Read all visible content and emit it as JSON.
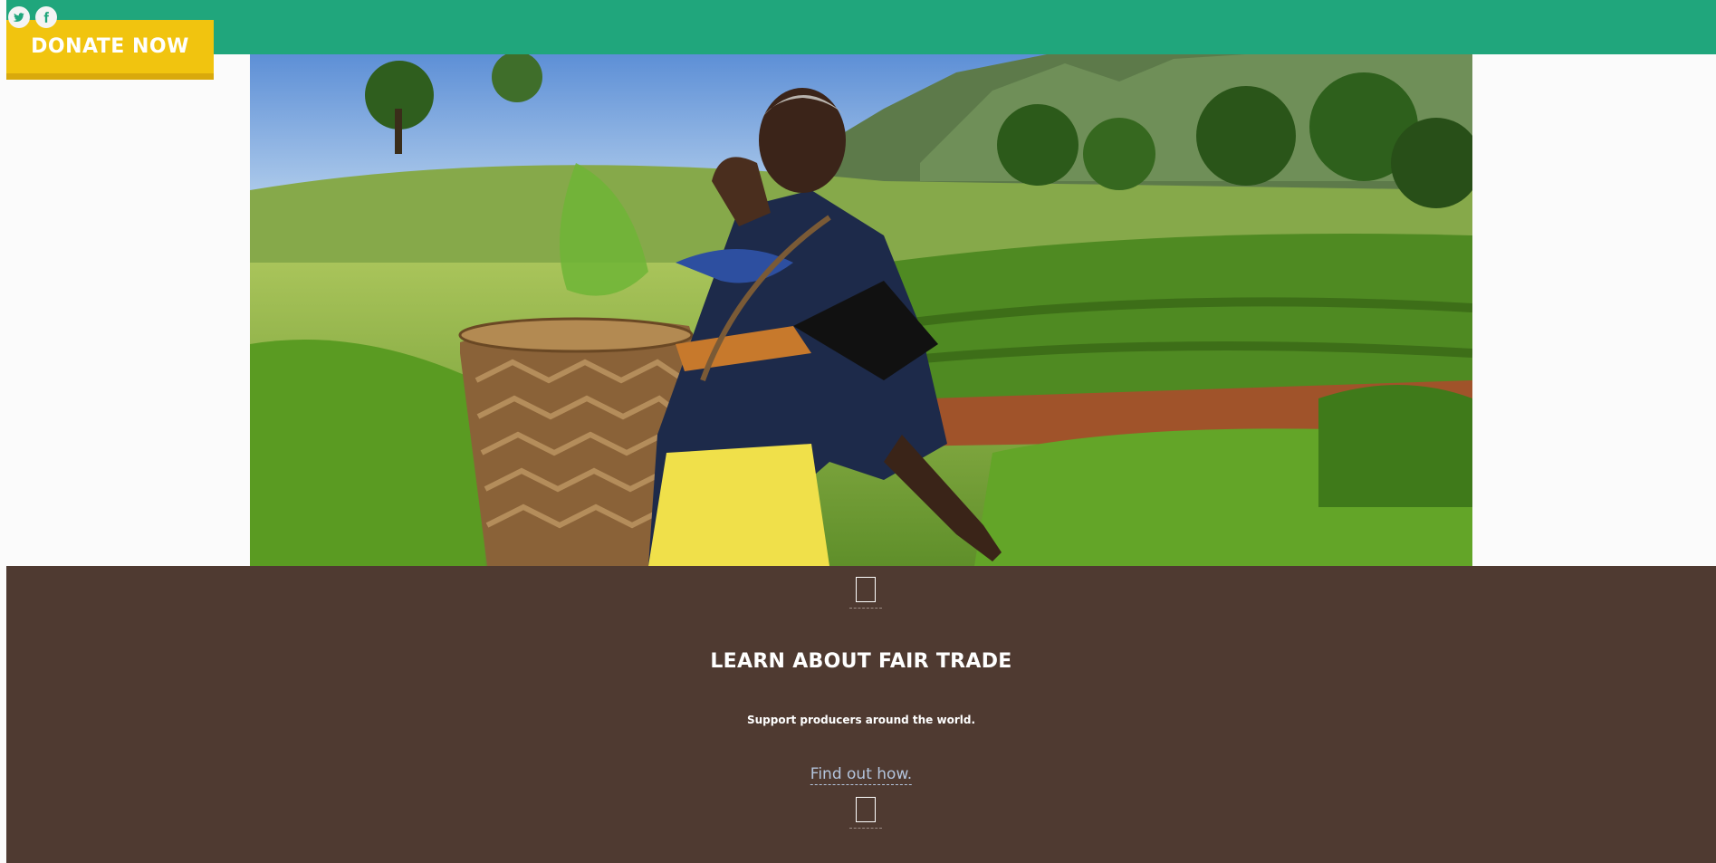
{
  "header": {
    "social_icons": [
      "twitter-icon",
      "facebook-icon"
    ],
    "donate_label": "DONATE NOW",
    "bar_color": "#20a67c",
    "donate_color": "#f1c40f"
  },
  "hero": {
    "image": "tea-farmer-photo"
  },
  "promo": {
    "title": "LEARN ABOUT FAIR TRADE",
    "subtitle": "Support producers around the world.",
    "link_label": "Find out how.",
    "background_color": "#4f3a31"
  }
}
